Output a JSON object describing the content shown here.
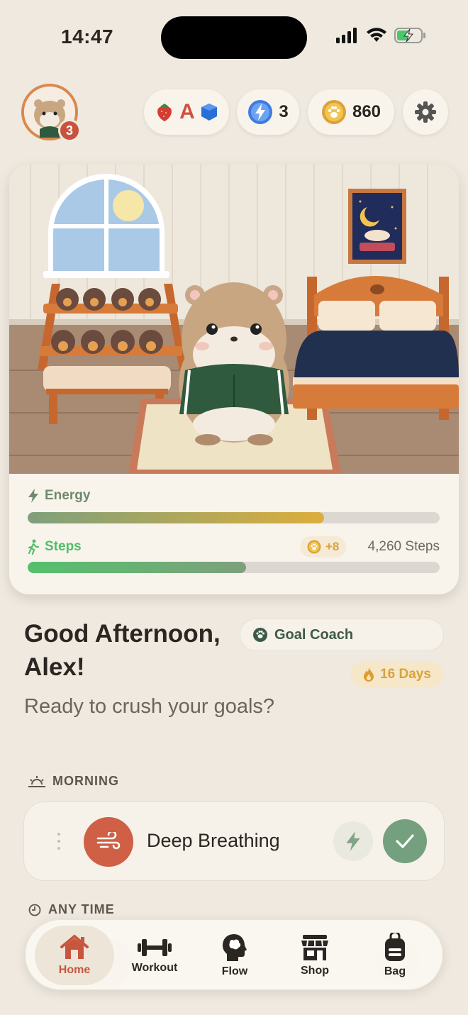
{
  "status_bar": {
    "time": "14:47"
  },
  "top_bar": {
    "avatar_badge": "3",
    "letters_pill": {
      "letter": "A"
    },
    "energy_pill": {
      "count": "3"
    },
    "coins_pill": {
      "count": "860"
    }
  },
  "stats": {
    "energy": {
      "label": "Energy",
      "fill_fraction": 0.72
    },
    "steps": {
      "label": "Steps",
      "fill_fraction": 0.53,
      "coin_reward": "+8",
      "steps_text": "4,260 Steps"
    }
  },
  "greeting": {
    "line": "Good Afternoon, Alex!",
    "subtitle": "Ready to crush your goals?",
    "coach_label": "Goal Coach",
    "streak_label": "16 Days"
  },
  "sections": {
    "morning": "MORNING",
    "any_time": "ANY TIME"
  },
  "tasks": [
    {
      "title": "Deep Breathing"
    }
  ],
  "tab_bar": {
    "tabs": [
      {
        "label": "Home",
        "icon": "home-icon"
      },
      {
        "label": "Workout",
        "icon": "dumbbell-icon"
      },
      {
        "label": "Flow",
        "icon": "brain-head-icon"
      },
      {
        "label": "Shop",
        "icon": "shop-icon"
      },
      {
        "label": "Bag",
        "icon": "bag-icon"
      }
    ],
    "active": "Home"
  },
  "colors": {
    "accent": "#c8553d",
    "green": "#75a07f",
    "gold": "#d7a43e",
    "background": "#efe9df"
  }
}
